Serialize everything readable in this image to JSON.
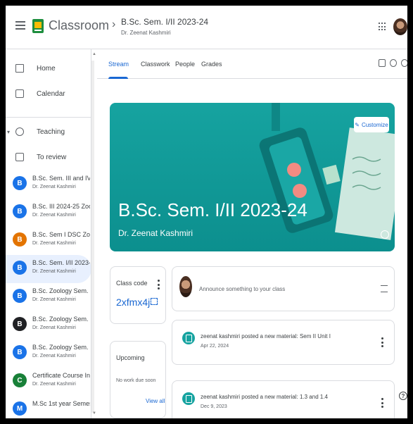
{
  "header": {
    "app_name": "Classroom",
    "separator": "›",
    "class_title": "B.Sc. Sem. I/II 2023-24",
    "class_owner": "Dr. Zeenat Kashmiri"
  },
  "sidebar": {
    "home": "Home",
    "calendar": "Calendar",
    "teaching": "Teaching",
    "to_review": "To review",
    "classes": [
      {
        "badge": "B",
        "color": "#1a73e8",
        "name": "B.Sc. Sem. III and IV 2024-...",
        "owner": "Dr. Zeenat Kashmiri"
      },
      {
        "badge": "B",
        "color": "#1a73e8",
        "name": "B.Sc. III 2024-25 Zoology",
        "owner": "Dr. Zeenat Kashmiri"
      },
      {
        "badge": "B",
        "color": "#e37400",
        "name": "B.Sc. Sem I DSC Zoology P...",
        "owner": "Dr. Zeenat Kashmiri"
      },
      {
        "badge": "B",
        "color": "#1a73e8",
        "name": "B.Sc. Sem. I/II 2023-24",
        "owner": "Dr. Zeenat Kashmiri"
      },
      {
        "badge": "B",
        "color": "#1a73e8",
        "name": "B.Sc. Zoology Sem. III/ IV 2...",
        "owner": "Dr. Zeenat Kashmiri"
      },
      {
        "badge": "B",
        "color": "#202124",
        "name": "B.Sc. Zoology Sem. I/II 202...",
        "owner": "Dr. Zeenat Kashmiri"
      },
      {
        "badge": "B",
        "color": "#1a73e8",
        "name": "B.Sc. Zoology Sem. V/VI 20...",
        "owner": "Dr. Zeenat Kashmiri"
      },
      {
        "badge": "C",
        "color": "#188038",
        "name": "Certificate Course In Verm...",
        "owner": "Dr. Zeenat Kashmiri"
      },
      {
        "badge": "M",
        "color": "#1a73e8",
        "name": "M.Sc 1st year Semester III",
        "owner": ""
      }
    ],
    "active_index": 3
  },
  "tabs": {
    "stream": "Stream",
    "classwork": "Classwork",
    "people": "People",
    "grades": "Grades"
  },
  "banner": {
    "title": "B.Sc. Sem. I/II 2023-24",
    "subtitle": "Dr. Zeenat Kashmiri",
    "customize": "Customize"
  },
  "class_code": {
    "label": "Class code",
    "value": "2xfmx4j"
  },
  "upcoming": {
    "title": "Upcoming",
    "empty": "No work due soon",
    "view_all": "View all"
  },
  "announce": {
    "placeholder": "Announce something to your class"
  },
  "posts": [
    {
      "title": "zeenat kashmiri posted a new material: Sem II Unit I",
      "date": "Apr 22, 2024"
    },
    {
      "title": "zeenat kashmiri posted a new material: 1.3 and 1.4",
      "date": "Dec 9, 2023"
    }
  ]
}
